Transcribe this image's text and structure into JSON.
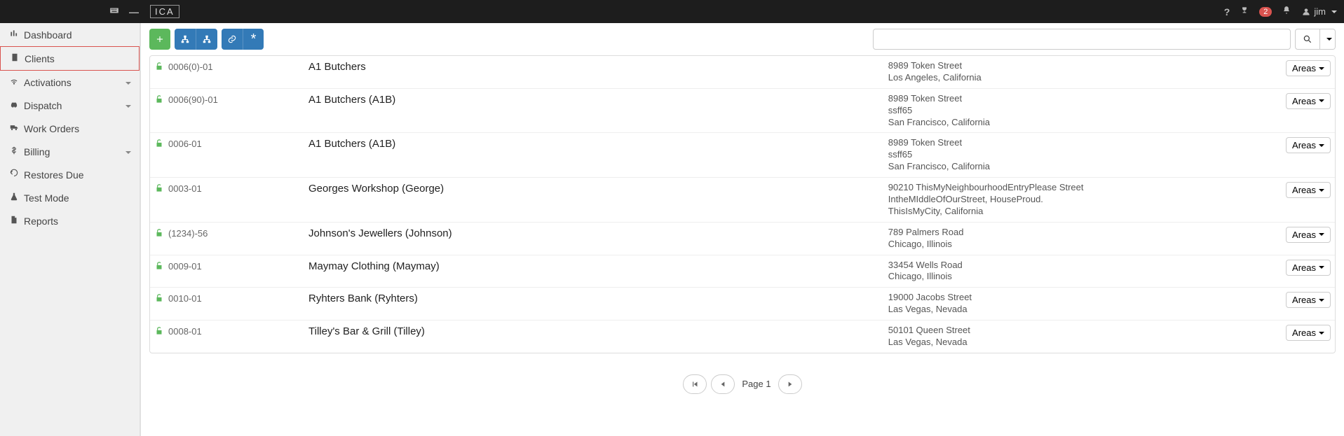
{
  "topbar": {
    "logo": "ICA",
    "notif_count": "2",
    "username": "jim"
  },
  "sidebar": {
    "items": [
      {
        "icon": "chart-icon",
        "label": "Dashboard",
        "expandable": false
      },
      {
        "icon": "building-icon",
        "label": "Clients",
        "expandable": false,
        "selected": true
      },
      {
        "icon": "wifi-icon",
        "label": "Activations",
        "expandable": true
      },
      {
        "icon": "car-icon",
        "label": "Dispatch",
        "expandable": true
      },
      {
        "icon": "truck-icon",
        "label": "Work Orders",
        "expandable": false
      },
      {
        "icon": "dollar-icon",
        "label": "Billing",
        "expandable": true
      },
      {
        "icon": "undo-icon",
        "label": "Restores Due",
        "expandable": false
      },
      {
        "icon": "flask-icon",
        "label": "Test Mode",
        "expandable": false
      },
      {
        "icon": "file-icon",
        "label": "Reports",
        "expandable": false
      }
    ]
  },
  "toolbar": {
    "areas_label": "Areas"
  },
  "search": {
    "value": "",
    "placeholder": ""
  },
  "clients": [
    {
      "code": "0006(0)-01",
      "name": "A1 Butchers",
      "address": [
        "8989 Token Street",
        "Los Angeles, California"
      ]
    },
    {
      "code": "0006(90)-01",
      "name": "A1 Butchers (A1B)",
      "address": [
        "8989 Token Street",
        "ssff65",
        "San Francisco, California"
      ]
    },
    {
      "code": "0006-01",
      "name": "A1 Butchers (A1B)",
      "address": [
        "8989 Token Street",
        "ssff65",
        "San Francisco, California"
      ]
    },
    {
      "code": "0003-01",
      "name": "Georges Workshop (George)",
      "address": [
        "90210 ThisMyNeighbourhoodEntryPlease Street",
        "IntheMIddleOfOurStreet, HouseProud.",
        "ThisIsMyCity, California"
      ]
    },
    {
      "code": "(1234)-56",
      "name": "Johnson's Jewellers (Johnson)",
      "address": [
        "789 Palmers Road",
        "Chicago, Illinois"
      ]
    },
    {
      "code": "0009-01",
      "name": "Maymay Clothing (Maymay)",
      "address": [
        "33454 Wells Road",
        "Chicago, Illinois"
      ]
    },
    {
      "code": "0010-01",
      "name": "Ryhters Bank (Ryhters)",
      "address": [
        "19000 Jacobs Street",
        "Las Vegas, Nevada"
      ]
    },
    {
      "code": "0008-01",
      "name": "Tilley's Bar & Grill (Tilley)",
      "address": [
        "50101 Queen Street",
        "Las Vegas, Nevada"
      ]
    }
  ],
  "pager": {
    "label": "Page 1"
  }
}
